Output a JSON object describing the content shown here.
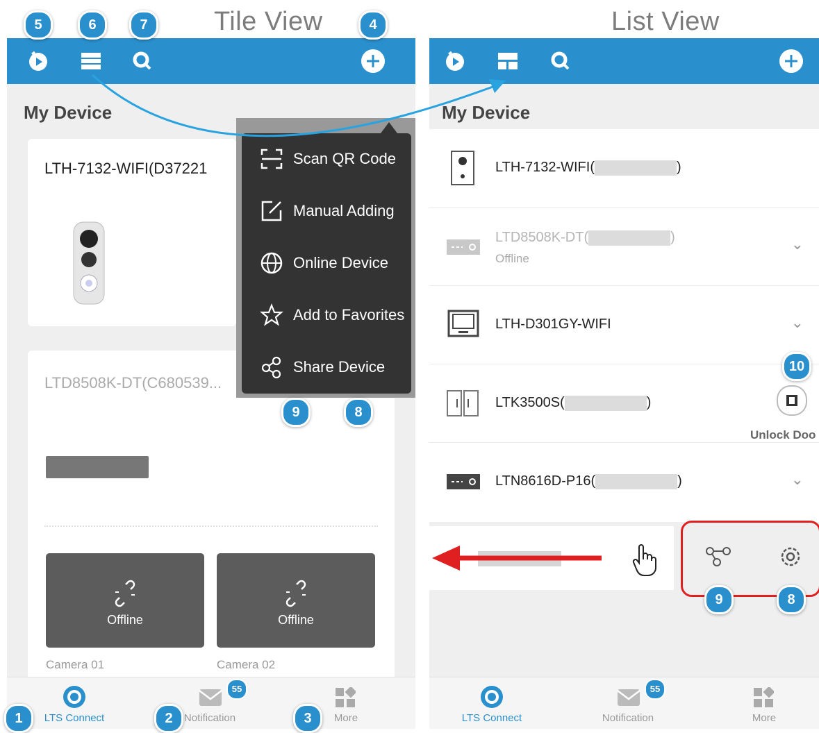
{
  "colors": {
    "accent": "#2a8fcd",
    "menu_bg": "#333333",
    "tile_bg": "#5c5c5c",
    "highlight": "#e02020"
  },
  "titles": {
    "tile_view": "Tile View",
    "list_view": "List View"
  },
  "callouts": {
    "n1": "1",
    "n2": "2",
    "n3": "3",
    "n4": "4",
    "n5": "5",
    "n6": "6",
    "n7": "7",
    "n8": "8",
    "n9": "9",
    "n10": "10"
  },
  "tile_view": {
    "section_title": "My Device",
    "topbar_icons": [
      "play-icon",
      "layout-icon",
      "search-icon",
      "add-icon"
    ],
    "card1": {
      "name": "LTH-7132-WIFI(D37221"
    },
    "card2": {
      "name": "LTD8508K-DT(C680539...",
      "cameras": [
        {
          "status": "Offline",
          "label": "Camera 01"
        },
        {
          "status": "Offline",
          "label": "Camera 02"
        }
      ]
    },
    "add_menu": [
      {
        "label": "Scan QR Code",
        "icon": "scan-icon"
      },
      {
        "label": "Manual Adding",
        "icon": "edit-icon"
      },
      {
        "label": "Online Device",
        "icon": "globe-icon"
      },
      {
        "label": "Add to Favorites",
        "icon": "star-icon"
      },
      {
        "label": "Share Device",
        "icon": "share-icon"
      }
    ],
    "nav": [
      {
        "label": "LTS Connect"
      },
      {
        "label": "Notification",
        "badge": "55"
      },
      {
        "label": "More"
      }
    ]
  },
  "list_view": {
    "section_title": "My Device",
    "rows": [
      {
        "prefix": "LTH-7132-WIFI(",
        "suffix": ")",
        "status": ""
      },
      {
        "prefix": "LTD8508K-DT(",
        "suffix": ")",
        "status": "Offline"
      },
      {
        "prefix": "LTH-D301GY-WIFI",
        "suffix": "",
        "status": ""
      },
      {
        "prefix": "LTK3500S(",
        "suffix": ")",
        "status": ""
      },
      {
        "prefix": "LTN8616D-P16(",
        "suffix": ")",
        "status": ""
      }
    ],
    "unlock_label": "Unlock Doo",
    "nav": [
      {
        "label": "LTS Connect"
      },
      {
        "label": "Notification",
        "badge": "55"
      },
      {
        "label": "More"
      }
    ]
  }
}
